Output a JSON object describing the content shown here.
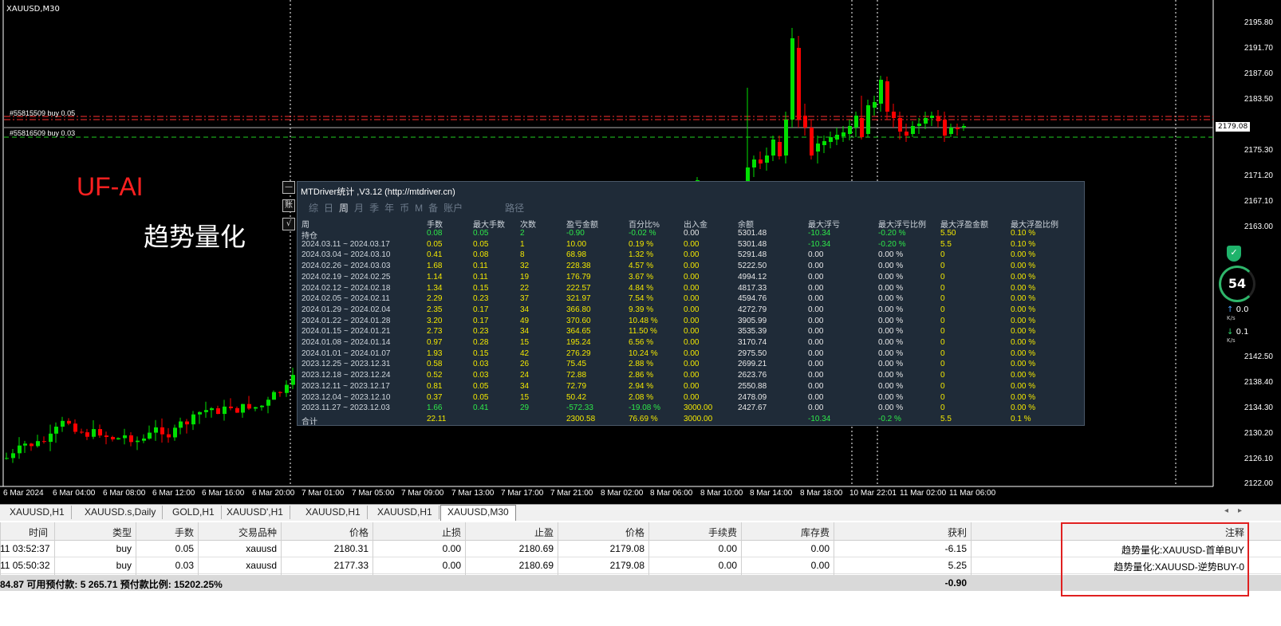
{
  "chart": {
    "symbol": "XAUUSD,M30",
    "current_price": "2179.08",
    "price_labels": [
      "2195.80",
      "2191.70",
      "2187.60",
      "2183.50",
      "2175.30",
      "2171.20",
      "2167.10",
      "2163.00",
      "2142.50",
      "2138.40",
      "2134.30",
      "2130.20",
      "2126.10",
      "2122.00"
    ],
    "time_labels": [
      "6 Mar 2024",
      "6 Mar 04:00",
      "6 Mar 08:00",
      "6 Mar 12:00",
      "6 Mar 16:00",
      "6 Mar 20:00",
      "7 Mar 01:00",
      "7 Mar 05:00",
      "7 Mar 09:00",
      "7 Mar 13:00",
      "7 Mar 17:00",
      "7 Mar 21:00",
      "8 Mar 02:00",
      "8 Mar 06:00",
      "8 Mar 10:00",
      "8 Mar 14:00",
      "8 Mar 18:00",
      "10 Mar 22:01",
      "11 Mar 02:00",
      "11 Mar 06:00"
    ],
    "order_labels": [
      "#55815509 buy 0.05",
      "#55816509 buy 0.03"
    ],
    "watermark_en": "UF-AI",
    "watermark_cn": "趋势量化",
    "colors": {
      "bull": "#00e000",
      "bear": "#ff0000",
      "background": "#000000"
    }
  },
  "net_widget": {
    "badge": "54",
    "up_value": "0.0",
    "down_value": "0.1",
    "unit": "K/s",
    "shield_icon": "shield-check-icon"
  },
  "stats": {
    "title": "MTDriver统计 ,V3.12 (http://mtdriver.cn)",
    "tabs": [
      "综",
      "日",
      "周",
      "月",
      "季",
      "年",
      "币",
      "M",
      "备",
      "账户"
    ],
    "active_tab": "周",
    "path_tab": "路径",
    "side_buttons": [
      "—",
      "账",
      "√"
    ],
    "columns": [
      "周",
      "手数",
      "最大手数",
      "次数",
      "盈亏金额",
      "百分比%",
      "出入金",
      "余额",
      "最大浮亏",
      "最大浮亏比例",
      "最大浮盈金额",
      "最大浮盈比例"
    ],
    "rows": [
      [
        "持仓",
        "0.08",
        "0.05",
        "2",
        "-0.90",
        "-0.02 %",
        "0.00",
        "5301.48",
        "-10.34",
        "-0.20 %",
        "5.50",
        "0.10 %"
      ],
      [
        "2024.03.11 ~ 2024.03.17",
        "0.05",
        "0.05",
        "1",
        "10.00",
        "0.19 %",
        "0.00",
        "5301.48",
        "-10.34",
        "-0.20 %",
        "5.5",
        "0.10 %"
      ],
      [
        "2024.03.04 ~ 2024.03.10",
        "0.41",
        "0.08",
        "8",
        "68.98",
        "1.32 %",
        "0.00",
        "5291.48",
        "0.00",
        "0.00 %",
        "0",
        "0.00 %"
      ],
      [
        "2024.02.26 ~ 2024.03.03",
        "1.68",
        "0.11",
        "32",
        "228.38",
        "4.57 %",
        "0.00",
        "5222.50",
        "0.00",
        "0.00 %",
        "0",
        "0.00 %"
      ],
      [
        "2024.02.19 ~ 2024.02.25",
        "1.14",
        "0.11",
        "19",
        "176.79",
        "3.67 %",
        "0.00",
        "4994.12",
        "0.00",
        "0.00 %",
        "0",
        "0.00 %"
      ],
      [
        "2024.02.12 ~ 2024.02.18",
        "1.34",
        "0.15",
        "22",
        "222.57",
        "4.84 %",
        "0.00",
        "4817.33",
        "0.00",
        "0.00 %",
        "0",
        "0.00 %"
      ],
      [
        "2024.02.05 ~ 2024.02.11",
        "2.29",
        "0.23",
        "37",
        "321.97",
        "7.54 %",
        "0.00",
        "4594.76",
        "0.00",
        "0.00 %",
        "0",
        "0.00 %"
      ],
      [
        "2024.01.29 ~ 2024.02.04",
        "2.35",
        "0.17",
        "34",
        "366.80",
        "9.39 %",
        "0.00",
        "4272.79",
        "0.00",
        "0.00 %",
        "0",
        "0.00 %"
      ],
      [
        "2024.01.22 ~ 2024.01.28",
        "3.20",
        "0.17",
        "49",
        "370.60",
        "10.48 %",
        "0.00",
        "3905.99",
        "0.00",
        "0.00 %",
        "0",
        "0.00 %"
      ],
      [
        "2024.01.15 ~ 2024.01.21",
        "2.73",
        "0.23",
        "34",
        "364.65",
        "11.50 %",
        "0.00",
        "3535.39",
        "0.00",
        "0.00 %",
        "0",
        "0.00 %"
      ],
      [
        "2024.01.08 ~ 2024.01.14",
        "0.97",
        "0.28",
        "15",
        "195.24",
        "6.56 %",
        "0.00",
        "3170.74",
        "0.00",
        "0.00 %",
        "0",
        "0.00 %"
      ],
      [
        "2024.01.01 ~ 2024.01.07",
        "1.93",
        "0.15",
        "42",
        "276.29",
        "10.24 %",
        "0.00",
        "2975.50",
        "0.00",
        "0.00 %",
        "0",
        "0.00 %"
      ],
      [
        "2023.12.25 ~ 2023.12.31",
        "0.58",
        "0.03",
        "26",
        "75.45",
        "2.88 %",
        "0.00",
        "2699.21",
        "0.00",
        "0.00 %",
        "0",
        "0.00 %"
      ],
      [
        "2023.12.18 ~ 2023.12.24",
        "0.52",
        "0.03",
        "24",
        "72.88",
        "2.86 %",
        "0.00",
        "2623.76",
        "0.00",
        "0.00 %",
        "0",
        "0.00 %"
      ],
      [
        "2023.12.11 ~ 2023.12.17",
        "0.81",
        "0.05",
        "34",
        "72.79",
        "2.94 %",
        "0.00",
        "2550.88",
        "0.00",
        "0.00 %",
        "0",
        "0.00 %"
      ],
      [
        "2023.12.04 ~ 2023.12.10",
        "0.37",
        "0.05",
        "15",
        "50.42",
        "2.08 %",
        "0.00",
        "2478.09",
        "0.00",
        "0.00 %",
        "0",
        "0.00 %"
      ],
      [
        "2023.11.27 ~ 2023.12.03",
        "1.66",
        "0.41",
        "29",
        "-572.33",
        "-19.08 %",
        "3000.00",
        "2427.67",
        "0.00",
        "0.00 %",
        "0",
        "0.00 %"
      ]
    ],
    "total": [
      "合计",
      "22.11",
      "",
      "",
      "2300.58",
      "76.69 %",
      "3000.00",
      "",
      "-10.34",
      "-0.2 %",
      "5.5",
      "0.1 %"
    ]
  },
  "tabs": [
    "XAUUSD,H1",
    "XAUUSD.s,Daily",
    "GOLD,H1",
    "XAUUSD',H1",
    "XAUUSD,H1",
    "XAUUSD,H1",
    "XAUUSD,M30"
  ],
  "active_tab_index": 6,
  "trades": {
    "headers": [
      "时间",
      "类型",
      "手数",
      "交易品种",
      "价格",
      "止损",
      "止盈",
      "价格",
      "手续费",
      "库存费",
      "获利",
      "注释"
    ],
    "rows": [
      [
        "11 03:52:37",
        "buy",
        "0.05",
        "xauusd",
        "2180.31",
        "0.00",
        "2180.69",
        "2179.08",
        "0.00",
        "0.00",
        "-6.15",
        "趋势量化:XAUUSD-首单BUY"
      ],
      [
        "11 05:50:32",
        "buy",
        "0.03",
        "xauusd",
        "2177.33",
        "0.00",
        "2180.69",
        "2179.08",
        "0.00",
        "0.00",
        "5.25",
        "趋势量化:XAUUSD-逆势BUY-0"
      ]
    ],
    "summary": "84.87  可用预付款: 5 265.71  预付款比例: 15202.25%",
    "summary_profit": "-0.90"
  }
}
